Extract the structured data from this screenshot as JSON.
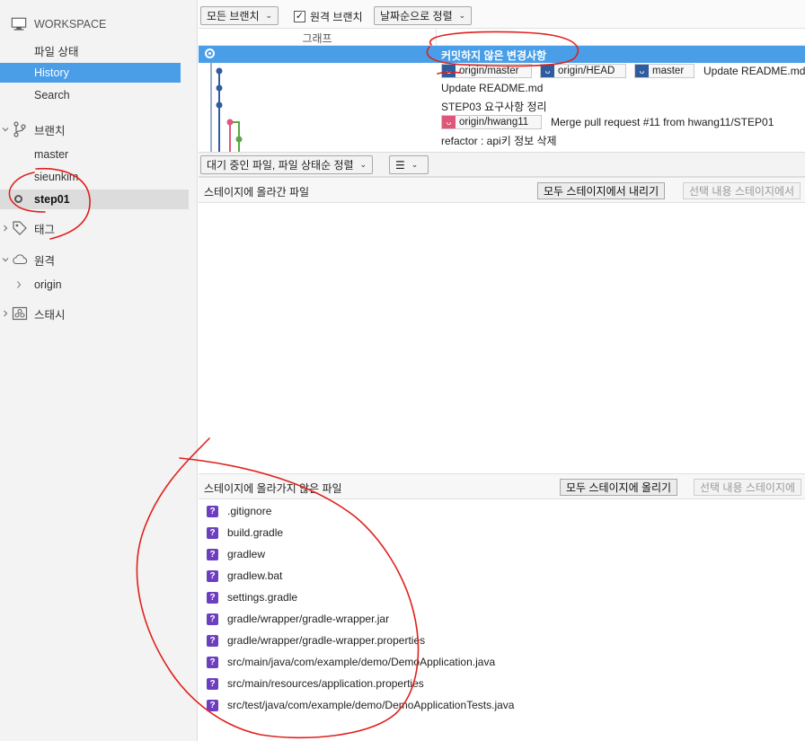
{
  "sidebar": {
    "workspace": "WORKSPACE",
    "file_status": "파일 상태",
    "history": "History",
    "search": "Search",
    "branches_header": "브랜치",
    "branches": [
      "master",
      "sieunkim",
      "step01"
    ],
    "tags_header": "태그",
    "remotes_header": "원격",
    "remotes": [
      "origin"
    ],
    "stashes_header": "스태시"
  },
  "toolbar": {
    "all_branches": "모든 브랜치",
    "remote_branches": "원격 브랜치",
    "remote_branches_checked": true,
    "sort_by_date": "날짜순으로 정렬"
  },
  "graph": {
    "header": "그래프",
    "rows": [
      {
        "message": "커밋하지 않은 변경사항",
        "refs": []
      },
      {
        "message": "Update README.md",
        "refs": [
          {
            "label": "origin/master",
            "color": "#2f5c9e"
          },
          {
            "label": "origin/HEAD",
            "color": "#2f5c9e"
          },
          {
            "label": "master",
            "color": "#2f5c9e"
          }
        ]
      },
      {
        "message": "Update README.md",
        "refs": []
      },
      {
        "message": "STEP03 요구사항 정리",
        "refs": []
      },
      {
        "message": "Merge pull request #11 from hwang11/STEP01",
        "refs": [
          {
            "label": "origin/hwang11",
            "color": "#e0567a"
          }
        ]
      },
      {
        "message": "refactor : api키 정보 삭제",
        "refs": []
      }
    ]
  },
  "pending": {
    "sort_dropdown": "대기 중인 파일, 파일 상태순 정렬",
    "view_icon": "list-icon"
  },
  "staged": {
    "title": "스테이지에 올라간 파일",
    "unstage_all": "모두 스테이지에서 내리기",
    "unstage_selected": "선택 내용 스테이지에서"
  },
  "unstaged": {
    "title": "스테이지에 올라가지 않은 파일",
    "stage_all": "모두 스테이지에 올리기",
    "stage_selected": "선택 내용 스테이지에",
    "files": [
      ".gitignore",
      "build.gradle",
      "gradlew",
      "gradlew.bat",
      "settings.gradle",
      "gradle/wrapper/gradle-wrapper.jar",
      "gradle/wrapper/gradle-wrapper.properties",
      "src/main/java/com/example/demo/DemoApplication.java",
      "src/main/resources/application.properties",
      "src/test/java/com/example/demo/DemoApplicationTests.java"
    ]
  },
  "colors": {
    "selection": "#4a9ee8",
    "ref_blue": "#2f5c9e",
    "ref_pink": "#e0567a",
    "untracked": "#6d3fc0",
    "annotation": "#e0201c"
  }
}
